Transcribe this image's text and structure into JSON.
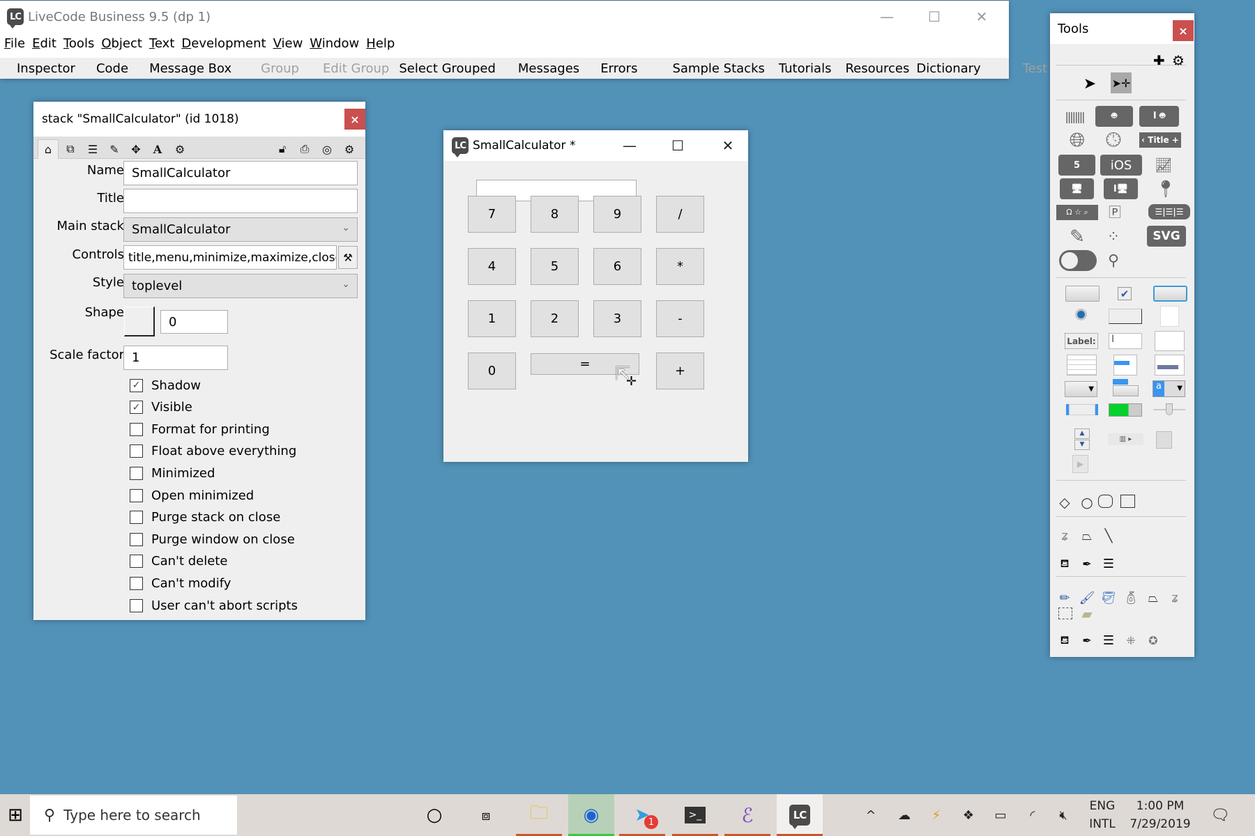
{
  "main_window": {
    "title": "LiveCode Business 9.5 (dp 1)",
    "controls": {
      "minimize": "—",
      "maximize": "☐",
      "close": "✕"
    },
    "menu": [
      "File",
      "Edit",
      "Tools",
      "Object",
      "Text",
      "Development",
      "View",
      "Window",
      "Help"
    ],
    "toolbar": [
      {
        "label": "Inspector",
        "enabled": true
      },
      {
        "label": "Code",
        "enabled": true
      },
      {
        "label": "Message Box",
        "enabled": true
      },
      {
        "label": "Group",
        "enabled": false
      },
      {
        "label": "Edit Group",
        "enabled": false
      },
      {
        "label": "Select Grouped",
        "enabled": true
      },
      {
        "label": "Messages",
        "enabled": true
      },
      {
        "label": "Errors",
        "enabled": true
      },
      {
        "label": "Sample Stacks",
        "enabled": true
      },
      {
        "label": "Tutorials",
        "enabled": true
      },
      {
        "label": "Resources",
        "enabled": true
      },
      {
        "label": "Dictionary",
        "enabled": true
      },
      {
        "label": "Test",
        "enabled": false
      }
    ]
  },
  "inspector": {
    "title": "stack \"SmallCalculator\" (id 1018)",
    "close": "×",
    "tabs_left": [
      "home-icon",
      "cards-icon",
      "database-icon",
      "pencil-icon",
      "move-icon",
      "text-icon",
      "gears-icon"
    ],
    "tabs_right": [
      "unlock-icon",
      "script-icon",
      "target-icon",
      "settings-icon"
    ],
    "labels": {
      "name": "Name",
      "title": "Title",
      "main_stack": "Main stack",
      "controls": "Controls",
      "style": "Style",
      "shape": "Shape",
      "scale_factor": "Scale factor"
    },
    "values": {
      "name": "SmallCalculator",
      "title": "",
      "main_stack": "SmallCalculator",
      "controls": "title,menu,minimize,maximize,close",
      "style": "toplevel",
      "shape": "0",
      "scale_factor": "1"
    },
    "checkboxes": [
      {
        "label": "Shadow",
        "checked": true
      },
      {
        "label": "Visible",
        "checked": true
      },
      {
        "label": "Format for printing",
        "checked": false
      },
      {
        "label": "Float above everything",
        "checked": false
      },
      {
        "label": "Minimized",
        "checked": false
      },
      {
        "label": "Open minimized",
        "checked": false
      },
      {
        "label": "Purge stack on close",
        "checked": false
      },
      {
        "label": "Purge window on close",
        "checked": false
      },
      {
        "label": "Can't delete",
        "checked": false
      },
      {
        "label": "Can't modify",
        "checked": false
      },
      {
        "label": "User can't abort scripts",
        "checked": false
      }
    ]
  },
  "calculator": {
    "title": "SmallCalculator *",
    "display": "",
    "buttons": [
      "7",
      "8",
      "9",
      "/",
      "4",
      "5",
      "6",
      "*",
      "1",
      "2",
      "3",
      "-",
      "0",
      "=",
      "+"
    ]
  },
  "tools": {
    "title": "Tools",
    "close": "×",
    "header_icons": {
      "add": "✚",
      "settings": "⚙"
    },
    "widget_labels": {
      "title_bar": "‹ Title +",
      "ios": "iOS",
      "svg": "SVG",
      "label": "Label:"
    }
  },
  "taskbar": {
    "search_placeholder": "Type here to search",
    "telegram_badge": "1",
    "lang_top": "ENG",
    "lang_bottom": "INTL",
    "time": "1:00 PM",
    "date": "7/29/2019"
  },
  "colors": {
    "desktop": "#5291b8",
    "close_red": "#c9504f",
    "toolbar_bg": "#eeeeee",
    "taskbar_bg": "#ded9d4"
  }
}
